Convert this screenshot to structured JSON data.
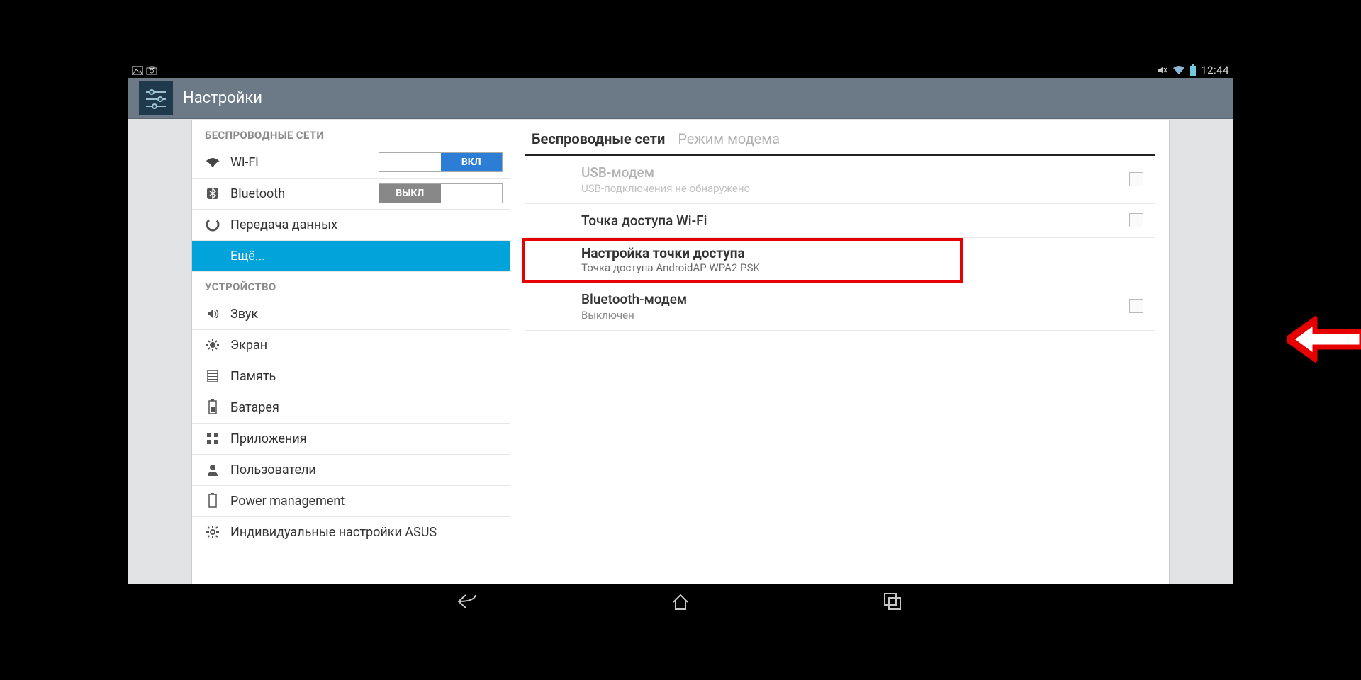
{
  "status": {
    "time": "12:44"
  },
  "header": {
    "title": "Настройки"
  },
  "sidebar": {
    "section1": "БЕСПРОВОДНЫЕ СЕТИ",
    "section2": "УСТРОЙСТВО",
    "wifi": {
      "label": "Wi-Fi",
      "toggle": "ВКЛ"
    },
    "bluetooth": {
      "label": "Bluetooth",
      "toggle": "ВЫКЛ"
    },
    "data": {
      "label": "Передача данных"
    },
    "more": {
      "label": "Ещё..."
    },
    "sound": {
      "label": "Звук"
    },
    "display": {
      "label": "Экран"
    },
    "storage": {
      "label": "Память"
    },
    "battery": {
      "label": "Батарея"
    },
    "apps": {
      "label": "Приложения"
    },
    "users": {
      "label": "Пользователи"
    },
    "power": {
      "label": "Power management"
    },
    "asus": {
      "label": "Индивидуальные настройки ASUS"
    }
  },
  "breadcrumb": {
    "curr": "Беспроводные сети",
    "path": "Режим модема"
  },
  "detail": {
    "usb": {
      "title": "USB-модем",
      "sub": "USB-подключения не обнаружено"
    },
    "hotspot": {
      "title": "Точка доступа Wi-Fi"
    },
    "config": {
      "title": "Настройка точки доступа",
      "sub": "Точка доступа AndroidAP WPA2 PSK"
    },
    "btmodem": {
      "title": "Bluetooth-модем",
      "sub": "Выключен"
    }
  }
}
